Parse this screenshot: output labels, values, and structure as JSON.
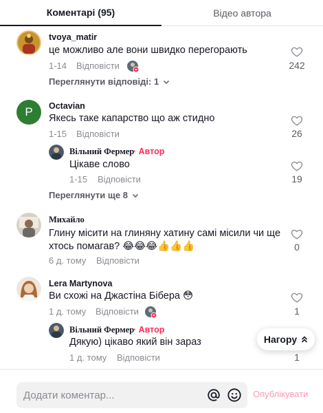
{
  "tabs": {
    "comments": "Коментарі (95)",
    "author_videos": "Відео автора"
  },
  "reply_label": "Відповісти",
  "author_badge": "Автор",
  "comments": [
    {
      "user": "tvoya_matir",
      "text": "це можливо але вони швидко перегорають",
      "date": "1-14",
      "likes": "242",
      "view_replies": "Переглянути відповіді: 1"
    },
    {
      "user": "Octavian",
      "avatar_letter": "P",
      "text": "Якесь таке капарство що аж стидно",
      "date": "1-15",
      "likes": "26",
      "reply": {
        "user": "Вільний Фермер",
        "text": "Цікаве слово",
        "date": "1-15",
        "likes": "19"
      },
      "view_more": "Переглянути ще 8"
    },
    {
      "user": "Михайло",
      "text": "Глину місити на глиняну хатину самі місили чи ще хтось помагав? 😂😂😂👍👍👍",
      "date": "6 д. тому",
      "likes": "0"
    },
    {
      "user": "Lera Martynova",
      "text": "Ви схожі на Джастіна Бібера 😳",
      "date": "1 д. тому",
      "likes": "1",
      "reply": {
        "user": "Вільний Фермер",
        "text": "Дякую) цікаво який він зараз",
        "date": "1 д. тому",
        "likes": "1"
      }
    }
  ],
  "scroll_top": "Нагору",
  "composer": {
    "placeholder": "Додати коментар...",
    "post": "Опублікувати"
  },
  "colors": {
    "accent": "#fe2c55",
    "muted": "#8a8b91",
    "octavian_avatar": "#2e7d32"
  }
}
